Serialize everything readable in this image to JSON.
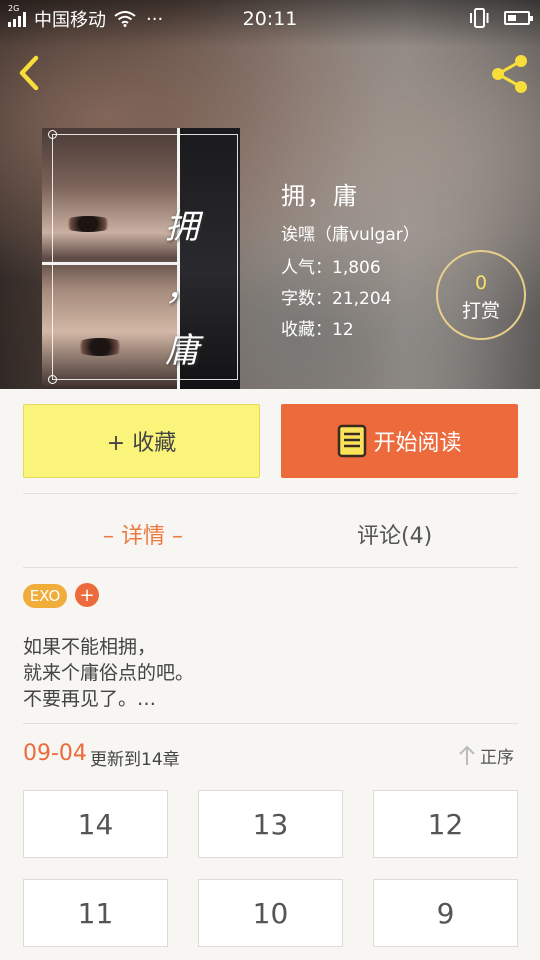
{
  "status_bar": {
    "network_tag": "2G",
    "carrier": "中国移动",
    "more": "···",
    "time": "20:11"
  },
  "book": {
    "title": "拥，庸",
    "cover_title_1": "拥",
    "cover_title_2": "，",
    "cover_title_3": "庸",
    "author": "诶嘿（庸vulgar）",
    "popularity": "人气：1,806",
    "word_count": "字数：21,204",
    "favorites": "收藏：12"
  },
  "tip": {
    "count": "0",
    "label": "打赏"
  },
  "actions": {
    "favorite_label": "+ 收藏",
    "read_label": "开始阅读"
  },
  "tabs": {
    "detail": "– 详情 –",
    "comments": "评论(4)"
  },
  "tags": {
    "items": [
      "EXO"
    ],
    "add": "+"
  },
  "description": {
    "lines": [
      "如果不能相拥，",
      "就来个庸俗点的吧。",
      "不要再见了。…"
    ]
  },
  "update": {
    "date": "09-04",
    "text": "更新到14章",
    "sort_label": "正序"
  },
  "chapters": [
    "14",
    "13",
    "12",
    "11",
    "10",
    "9"
  ],
  "colors": {
    "accent": "#ec6a3b",
    "favorite_bg": "#fbf47a",
    "tab_active": "#ec7a40",
    "tag_bg": "#f0ad3a",
    "nav_icon": "#f7de3a"
  },
  "icons": {
    "back": "chevron-left-icon",
    "share": "share-icon",
    "read": "book-icon",
    "sort": "arrow-up-icon"
  }
}
